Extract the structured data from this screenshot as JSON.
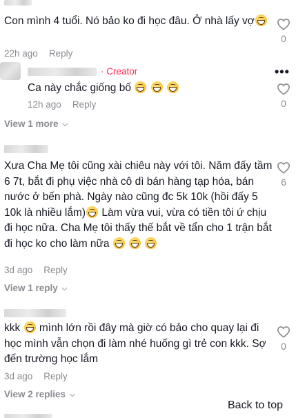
{
  "comments": [
    {
      "text": "Con mình 4 tuổi. Nó bảo ko đi học đâu. Ở nhà lấy vợ",
      "time": "22h ago",
      "reply_label": "Reply",
      "likes": "0"
    },
    {
      "creator_label": "· Creator",
      "text": "Ca này chắc giống bố",
      "time": "12h ago",
      "reply_label": "Reply",
      "likes": "0"
    },
    {
      "text": "Xưa Cha Mẹ tôi cũng xài chiêu này với tôi. Năm đấy tầm 6 7t, bắt đi phụ việc nhà cô dì bán hàng tạp hóa, bán nước ở bến phà. Ngày nào cũng đc 5k 10k (hồi đấy 5 10k là nhiều lắm)",
      "text_b": " Làm vừa vui, vừa có tiền tôi ứ chịu đi học nữa. Cha Mẹ tôi thấy thế bắt về tẩn cho 1 trận bắt đi học ko cho làm nữa ",
      "time": "3d ago",
      "reply_label": "Reply",
      "likes": "6"
    },
    {
      "text_a": "kkk ",
      "text": " mình lớn rồi đây mà giờ có bảo cho quay lại đi học mình vẫn chọn đi làm nhé huống gì trẻ con kkk. Sợ đến trường học lắm",
      "time": "3d ago",
      "reply_label": "Reply",
      "likes": "0"
    }
  ],
  "view_more": [
    "View 1 more",
    "View 1 reply",
    "View 2 replies"
  ],
  "back_to_top": "Back to top"
}
